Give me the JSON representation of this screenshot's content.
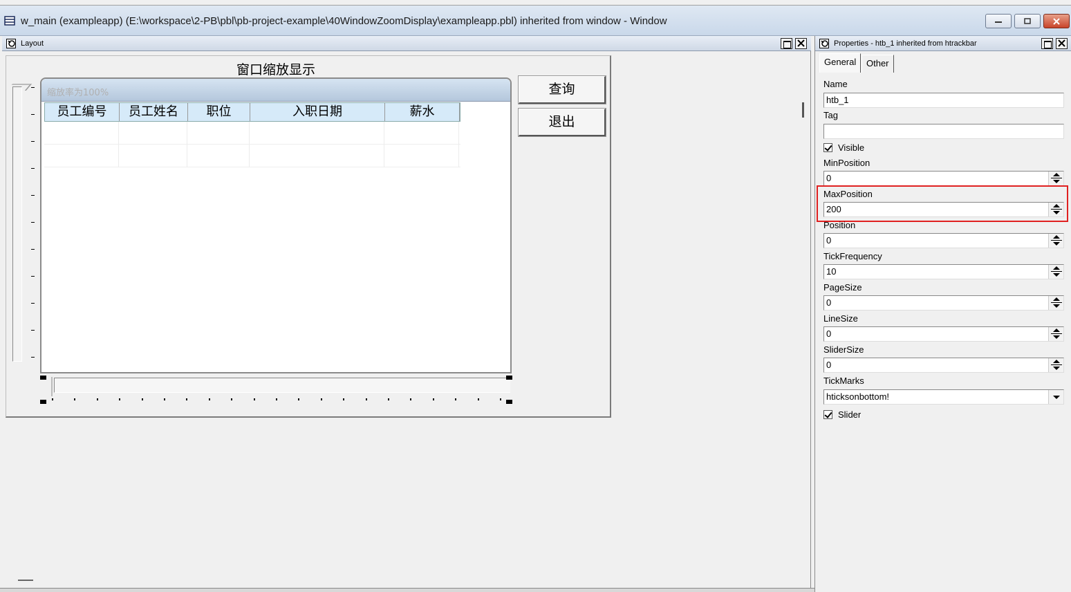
{
  "window": {
    "title": "w_main (exampleapp) (E:\\workspace\\2-PB\\pbl\\pb-project-example\\40WindowZoomDisplay\\exampleapp.pbl) inherited from window - Window"
  },
  "layout_pane": {
    "title": "Layout",
    "designed_window": {
      "title": "窗口缩放显示",
      "groupbox_title": "缩放率为100%",
      "grid_columns": [
        "员工编号",
        "员工姓名",
        "职位",
        "入职日期",
        "薪水"
      ],
      "grid_rows": 2,
      "buttons": {
        "query": "查询",
        "exit": "退出"
      }
    }
  },
  "properties_pane": {
    "title": "Properties - htb_1 inherited from htrackbar",
    "tabs": [
      {
        "label": "General",
        "active": true
      },
      {
        "label": "Other",
        "active": false
      }
    ],
    "fields": {
      "name_label": "Name",
      "name_value": "htb_1",
      "tag_label": "Tag",
      "tag_value": "",
      "visible_label": "Visible",
      "visible_checked": true,
      "minposition_label": "MinPosition",
      "minposition_value": "0",
      "maxposition_label": "MaxPosition",
      "maxposition_value": "200",
      "position_label": "Position",
      "position_value": "0",
      "tickfrequency_label": "TickFrequency",
      "tickfrequency_value": "10",
      "pagesize_label": "PageSize",
      "pagesize_value": "0",
      "linesize_label": "LineSize",
      "linesize_value": "0",
      "slidersize_label": "SliderSize",
      "slidersize_value": "0",
      "tickmarks_label": "TickMarks",
      "tickmarks_value": "hticksonbottom!",
      "slider_label": "Slider",
      "slider_checked": true
    },
    "highlight_color": "#e02020"
  }
}
